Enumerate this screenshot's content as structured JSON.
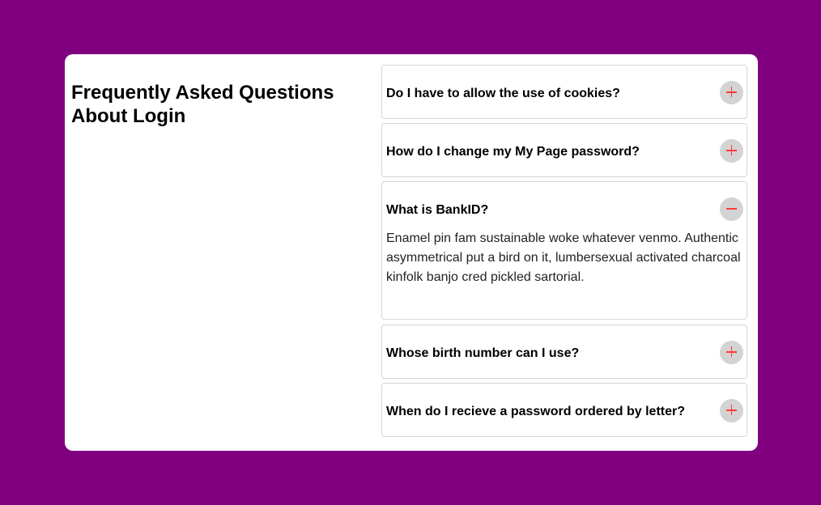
{
  "page": {
    "title": "Frequently Asked Questions About Login",
    "background_color": "#800080",
    "card_color": "#ffffff",
    "toggle_color": "#d3d3d3",
    "toggle_symbol_color": "#ff3b3b"
  },
  "faq": {
    "items": [
      {
        "question": "Do I have to allow the use of cookies?",
        "open": false,
        "toggle_icon": "plus-icon"
      },
      {
        "question": "How do I change my My Page password?",
        "open": false,
        "toggle_icon": "plus-icon"
      },
      {
        "question": "What is BankID?",
        "open": true,
        "toggle_icon": "minus-icon",
        "answer": "Enamel pin fam sustainable woke whatever venmo. Authentic asymmetrical put a bird on it, lumbersexual activated charcoal kinfolk banjo cred pickled sartorial."
      },
      {
        "question": "Whose birth number can I use?",
        "open": false,
        "toggle_icon": "plus-icon"
      },
      {
        "question": "When do I recieve a password ordered by letter?",
        "open": false,
        "toggle_icon": "plus-icon"
      }
    ]
  }
}
